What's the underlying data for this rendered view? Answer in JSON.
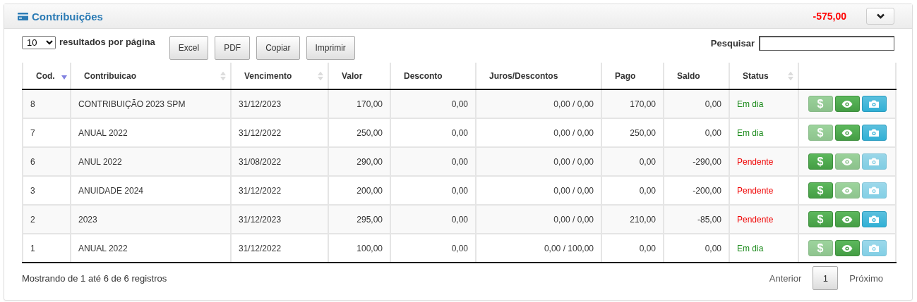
{
  "panel": {
    "title": "Contribuições",
    "total": "-575,00"
  },
  "toolbar": {
    "page_size": "10",
    "page_size_label": "resultados por página",
    "buttons": [
      "Excel",
      "PDF",
      "Copiar",
      "Imprimir"
    ],
    "search_label": "Pesquisar"
  },
  "table": {
    "columns": [
      {
        "label": "Cod.",
        "sortable": true,
        "sorted": true
      },
      {
        "label": "Contribuicao",
        "sortable": true,
        "sorted": false
      },
      {
        "label": "Vencimento",
        "sortable": true,
        "sorted": false
      },
      {
        "label": "Valor",
        "sortable": false
      },
      {
        "label": "Desconto",
        "sortable": false
      },
      {
        "label": "Juros/Descontos",
        "sortable": false
      },
      {
        "label": "Pago",
        "sortable": false
      },
      {
        "label": "Saldo",
        "sortable": false
      },
      {
        "label": "Status",
        "sortable": true,
        "sorted": false
      }
    ],
    "rows": [
      {
        "cells": [
          "8",
          "CONTRIBUIÇÃO 2023 SPM",
          "31/12/2023",
          "170,00",
          "0,00",
          "0,00 / 0,00",
          "170,00",
          "0,00"
        ],
        "status": {
          "label": "Em dia",
          "kind": "ok"
        },
        "actions": [
          {
            "kind": "pay",
            "label": "$",
            "disabled": true
          },
          {
            "kind": "view",
            "disabled": false
          },
          {
            "kind": "photo",
            "disabled": false
          }
        ]
      },
      {
        "cells": [
          "7",
          "ANUAL 2022",
          "31/12/2022",
          "250,00",
          "0,00",
          "0,00 / 0,00",
          "250,00",
          "0,00"
        ],
        "status": {
          "label": "Em dia",
          "kind": "ok"
        },
        "actions": [
          {
            "kind": "pay",
            "label": "$",
            "disabled": true
          },
          {
            "kind": "view",
            "disabled": false
          },
          {
            "kind": "photo",
            "disabled": false
          }
        ]
      },
      {
        "cells": [
          "6",
          "ANUL 2022",
          "31/08/2022",
          "290,00",
          "0,00",
          "0,00 / 0,00",
          "0,00",
          "-290,00"
        ],
        "status": {
          "label": "Pendente",
          "kind": "pending"
        },
        "actions": [
          {
            "kind": "pay",
            "label": "$",
            "disabled": false
          },
          {
            "kind": "view",
            "disabled": true
          },
          {
            "kind": "photo",
            "disabled": true
          }
        ]
      },
      {
        "cells": [
          "3",
          "ANUIDADE 2024",
          "31/12/2022",
          "200,00",
          "0,00",
          "0,00 / 0,00",
          "0,00",
          "-200,00"
        ],
        "status": {
          "label": "Pendente",
          "kind": "pending"
        },
        "actions": [
          {
            "kind": "pay",
            "label": "$",
            "disabled": false
          },
          {
            "kind": "view",
            "disabled": true
          },
          {
            "kind": "photo",
            "disabled": true
          }
        ]
      },
      {
        "cells": [
          "2",
          "2023",
          "31/12/2023",
          "295,00",
          "0,00",
          "0,00 / 0,00",
          "210,00",
          "-85,00"
        ],
        "status": {
          "label": "Pendente",
          "kind": "pending"
        },
        "actions": [
          {
            "kind": "pay",
            "label": "$",
            "disabled": false
          },
          {
            "kind": "view",
            "disabled": false
          },
          {
            "kind": "photo",
            "disabled": false
          }
        ]
      },
      {
        "cells": [
          "1",
          "ANUAL 2022",
          "31/12/2022",
          "100,00",
          "0,00",
          "0,00 / 100,00",
          "0,00",
          "0,00"
        ],
        "status": {
          "label": "Em dia",
          "kind": "ok"
        },
        "actions": [
          {
            "kind": "pay",
            "label": "$",
            "disabled": true
          },
          {
            "kind": "view",
            "disabled": false
          },
          {
            "kind": "photo",
            "disabled": true
          }
        ]
      }
    ]
  },
  "footer": {
    "info": "Mostrando de 1 até 6 de 6 registros",
    "previous": "Anterior",
    "pages": [
      {
        "label": "1",
        "selected": true
      }
    ],
    "next": "Próximo"
  }
}
